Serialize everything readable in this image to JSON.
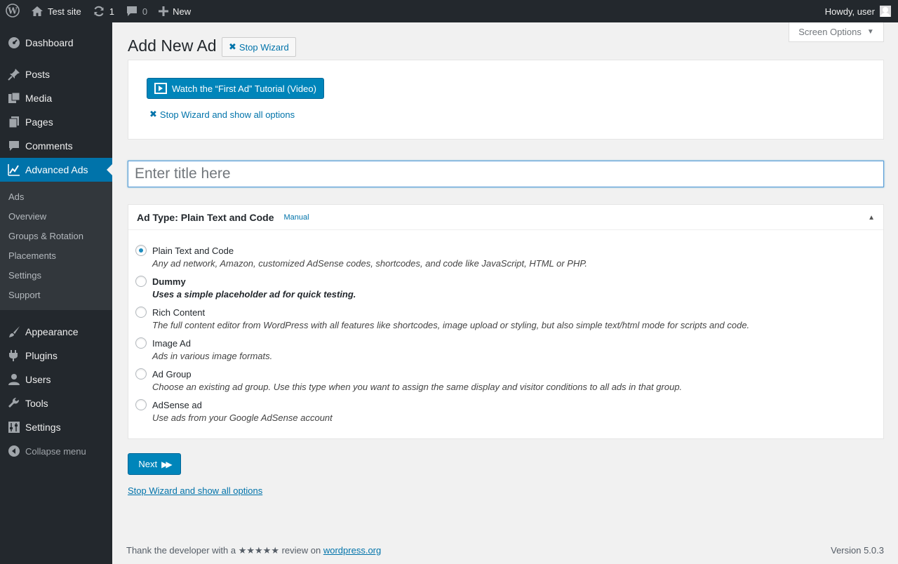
{
  "adminbar": {
    "site_name": "Test site",
    "updates_count": "1",
    "comments_count": "0",
    "new_label": "New",
    "greeting": "Howdy, user"
  },
  "sidebar": {
    "items": [
      {
        "label": "Dashboard",
        "icon": "dashboard-icon"
      },
      {
        "label": "Posts",
        "icon": "pin-icon"
      },
      {
        "label": "Media",
        "icon": "media-icon"
      },
      {
        "label": "Pages",
        "icon": "pages-icon"
      },
      {
        "label": "Comments",
        "icon": "comment-icon"
      },
      {
        "label": "Advanced Ads",
        "icon": "chart-icon"
      },
      {
        "label": "Appearance",
        "icon": "brush-icon"
      },
      {
        "label": "Plugins",
        "icon": "plugin-icon"
      },
      {
        "label": "Users",
        "icon": "user-icon"
      },
      {
        "label": "Tools",
        "icon": "wrench-icon"
      },
      {
        "label": "Settings",
        "icon": "sliders-icon"
      }
    ],
    "submenu": [
      "Ads",
      "Overview",
      "Groups & Rotation",
      "Placements",
      "Settings",
      "Support"
    ],
    "collapse_label": "Collapse menu"
  },
  "screen_options": "Screen Options",
  "page": {
    "title": "Add New Ad",
    "stop_wizard_label": "Stop Wizard",
    "watch_tutorial_label": "Watch the “First Ad” Tutorial (Video)",
    "stop_wizard_show_all": "Stop Wizard and show all options",
    "title_placeholder": "Enter title here"
  },
  "adtype": {
    "title": "Ad Type: Plain Text and Code",
    "manual_label": "Manual",
    "selected": "Plain Text and Code",
    "options": [
      {
        "label": "Plain Text and Code",
        "desc": "Any ad network, Amazon, customized AdSense codes, shortcodes, and code like JavaScript, HTML or PHP."
      },
      {
        "label": "Dummy",
        "desc": "Uses a simple placeholder ad for quick testing."
      },
      {
        "label": "Rich Content",
        "desc": "The full content editor from WordPress with all features like shortcodes, image upload or styling, but also simple text/html mode for scripts and code."
      },
      {
        "label": "Image Ad",
        "desc": "Ads in various image formats."
      },
      {
        "label": "Ad Group",
        "desc": "Choose an existing ad group. Use this type when you want to assign the same display and visitor conditions to all ads in that group."
      },
      {
        "label": "AdSense ad",
        "desc": "Use ads from your Google AdSense account"
      }
    ]
  },
  "next_label": "Next",
  "footer": {
    "thank_prefix": "Thank the developer with a ★★★★★ review on",
    "thank_link": "wordpress.org",
    "version": "Version 5.0.3"
  },
  "colors": {
    "adminbar_bg": "#23282d",
    "accent": "#0073aa",
    "button_primary": "#0085ba"
  }
}
